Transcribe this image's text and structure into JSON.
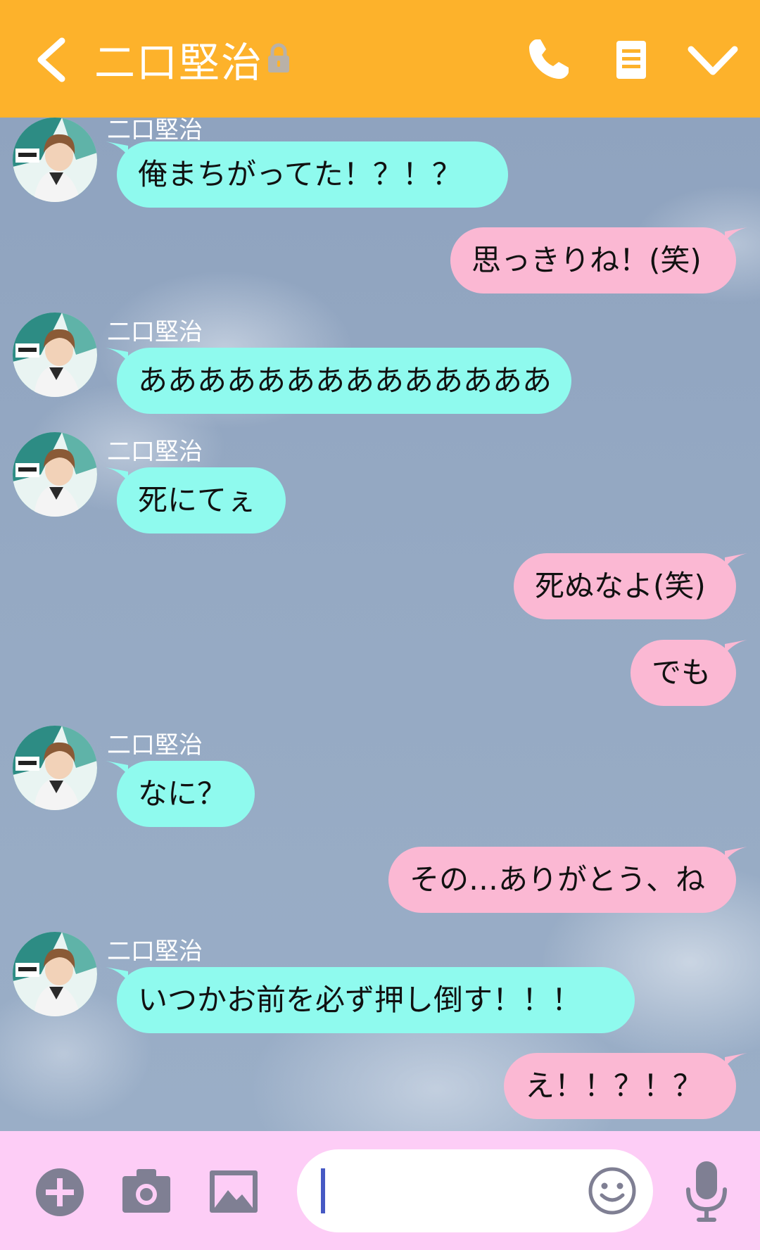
{
  "header": {
    "contact_name": "二口堅治",
    "colors": {
      "bar": "#fdb22b",
      "icon": "#ffffff"
    },
    "icons": [
      "chevron-left-icon",
      "lock-icon",
      "phone-icon",
      "notes-icon",
      "chevron-down-icon"
    ]
  },
  "messages": [
    {
      "side": "in",
      "sender": "二口堅治",
      "text": "俺まちがってた！？！？"
    },
    {
      "side": "out",
      "text": "思っきりね！(笑)"
    },
    {
      "side": "in",
      "sender": "二口堅治",
      "text": "ああああああああああああああ"
    },
    {
      "side": "in",
      "sender": "二口堅治",
      "text": "死にてぇ"
    },
    {
      "side": "out",
      "text": "死ぬなよ(笑)"
    },
    {
      "side": "out",
      "text": "でも"
    },
    {
      "side": "in",
      "sender": "二口堅治",
      "text": "なに？"
    },
    {
      "side": "out",
      "text": "その…ありがとう、ね"
    },
    {
      "side": "in",
      "sender": "二口堅治",
      "text": "いつかお前を必ず押し倒す！！！"
    },
    {
      "side": "out",
      "text": "え！！？！？"
    }
  ],
  "input": {
    "value": "",
    "icons": [
      "plus-icon",
      "camera-icon",
      "image-icon",
      "emoji-icon",
      "mic-icon"
    ],
    "colors": {
      "bar": "#fdcdf6",
      "icon": "#7f7f93",
      "caret": "#4659c4"
    }
  },
  "bubble_colors": {
    "incoming": "#8ffaee",
    "outgoing": "#fbb8d3"
  }
}
